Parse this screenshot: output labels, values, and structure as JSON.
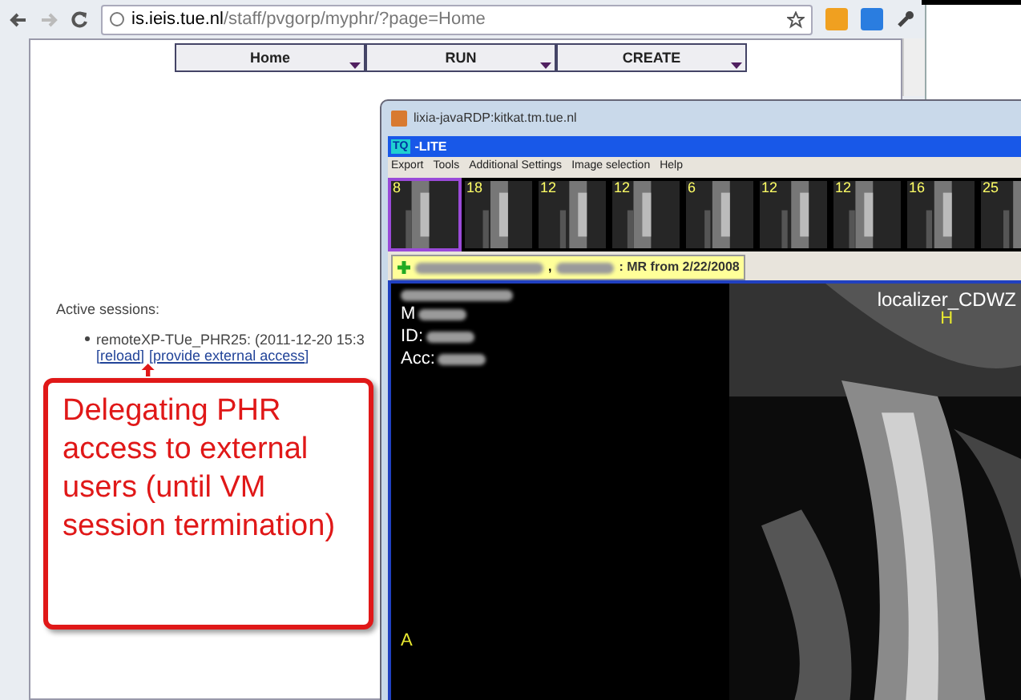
{
  "browser": {
    "url_host": "is.ieis.tue.nl",
    "url_path": "/staff/pvgorp/myphr/?page=Home",
    "nav": [
      {
        "label": "Home"
      },
      {
        "label": "RUN"
      },
      {
        "label": "CREATE"
      }
    ],
    "sessions_heading": "Active sessions:",
    "sessions": [
      {
        "name": "remoteXP-TUe_PHR25: (2011-12-20 15:3",
        "links": [
          "[reload]",
          "[provide external access]"
        ]
      }
    ]
  },
  "rdp_window": {
    "title": "lixia-javaRDP:kitkat.tm.tue.nl",
    "app_title": "-LITE",
    "app_badge": "TQ",
    "menu": [
      "Export",
      "Tools",
      "Additional Settings",
      "Image selection",
      "Help"
    ],
    "thumbnails": [
      {
        "count": "8",
        "selected": true
      },
      {
        "count": "18",
        "selected": false
      },
      {
        "count": "12",
        "selected": false
      },
      {
        "count": "12",
        "selected": false
      },
      {
        "count": "6",
        "selected": false
      },
      {
        "count": "12",
        "selected": false
      },
      {
        "count": "12",
        "selected": false
      },
      {
        "count": "16",
        "selected": false
      },
      {
        "count": "25",
        "selected": false
      }
    ],
    "study_tab": {
      "separator": ",",
      "text": ": MR from 2/22/2008"
    },
    "overlay": {
      "fields": [
        "M",
        "ID:",
        "Acc:"
      ],
      "series": "localizer_CDWZ",
      "top_marker": "H",
      "bottom_marker": "A"
    }
  },
  "callout": {
    "text": "Delegating PHR access to external users (until VM session termination)"
  }
}
